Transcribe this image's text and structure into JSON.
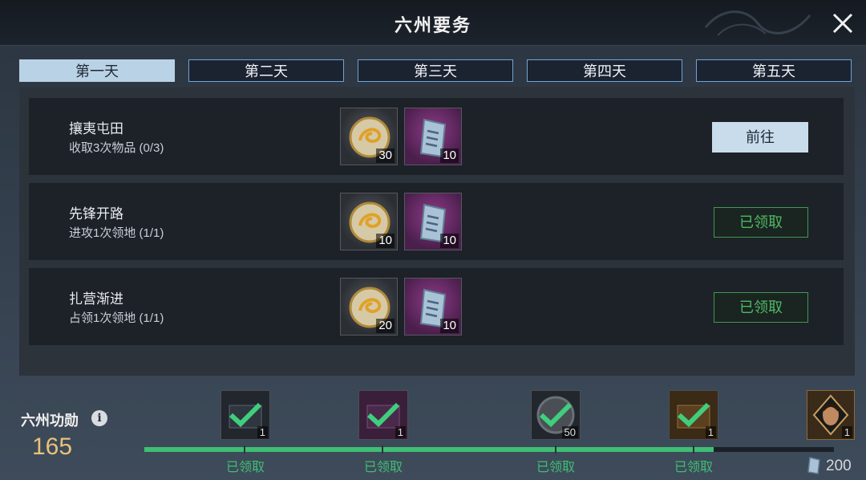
{
  "window": {
    "title": "六州要务"
  },
  "tabs": [
    {
      "label": "第一天",
      "active": true
    },
    {
      "label": "第二天",
      "active": false
    },
    {
      "label": "第三天",
      "active": false
    },
    {
      "label": "第四天",
      "active": false
    },
    {
      "label": "第五天",
      "active": false
    }
  ],
  "tasks": [
    {
      "name": "攘夷屯田",
      "desc": "收取3次物品 (0/3)",
      "rewards": [
        {
          "icon": "dragon-coin-icon",
          "qty": "30"
        },
        {
          "icon": "seal-token-icon",
          "qty": "10"
        }
      ],
      "action": "前往",
      "state": "go"
    },
    {
      "name": "先锋开路",
      "desc": "进攻1次领地 (1/1)",
      "rewards": [
        {
          "icon": "dragon-coin-icon",
          "qty": "10"
        },
        {
          "icon": "seal-token-icon",
          "qty": "10"
        }
      ],
      "action": "已领取",
      "state": "claimed"
    },
    {
      "name": "扎营渐进",
      "desc": "占领1次领地 (1/1)",
      "rewards": [
        {
          "icon": "dragon-coin-icon",
          "qty": "20"
        },
        {
          "icon": "seal-token-icon",
          "qty": "10"
        }
      ],
      "action": "已领取",
      "state": "claimed"
    }
  ],
  "merit": {
    "label": "六州功勋",
    "value": "165",
    "progress_fraction": 0.825,
    "total": "200",
    "milestones": [
      {
        "qty": "1",
        "status": "已领取",
        "icon": "dark-chest-icon"
      },
      {
        "qty": "1",
        "status": "已领取",
        "icon": "purple-chest-icon"
      },
      {
        "qty": "50",
        "status": "已领取",
        "icon": "gray-coin-icon"
      },
      {
        "qty": "1",
        "status": "已领取",
        "icon": "gold-chest-icon"
      },
      {
        "qty": "1",
        "status": "",
        "icon": "general-portrait-icon"
      }
    ]
  },
  "colors": {
    "accent_blue": "#6fa4d6",
    "claimed_green": "#3fbf74",
    "merit_gold": "#e8c27a"
  }
}
